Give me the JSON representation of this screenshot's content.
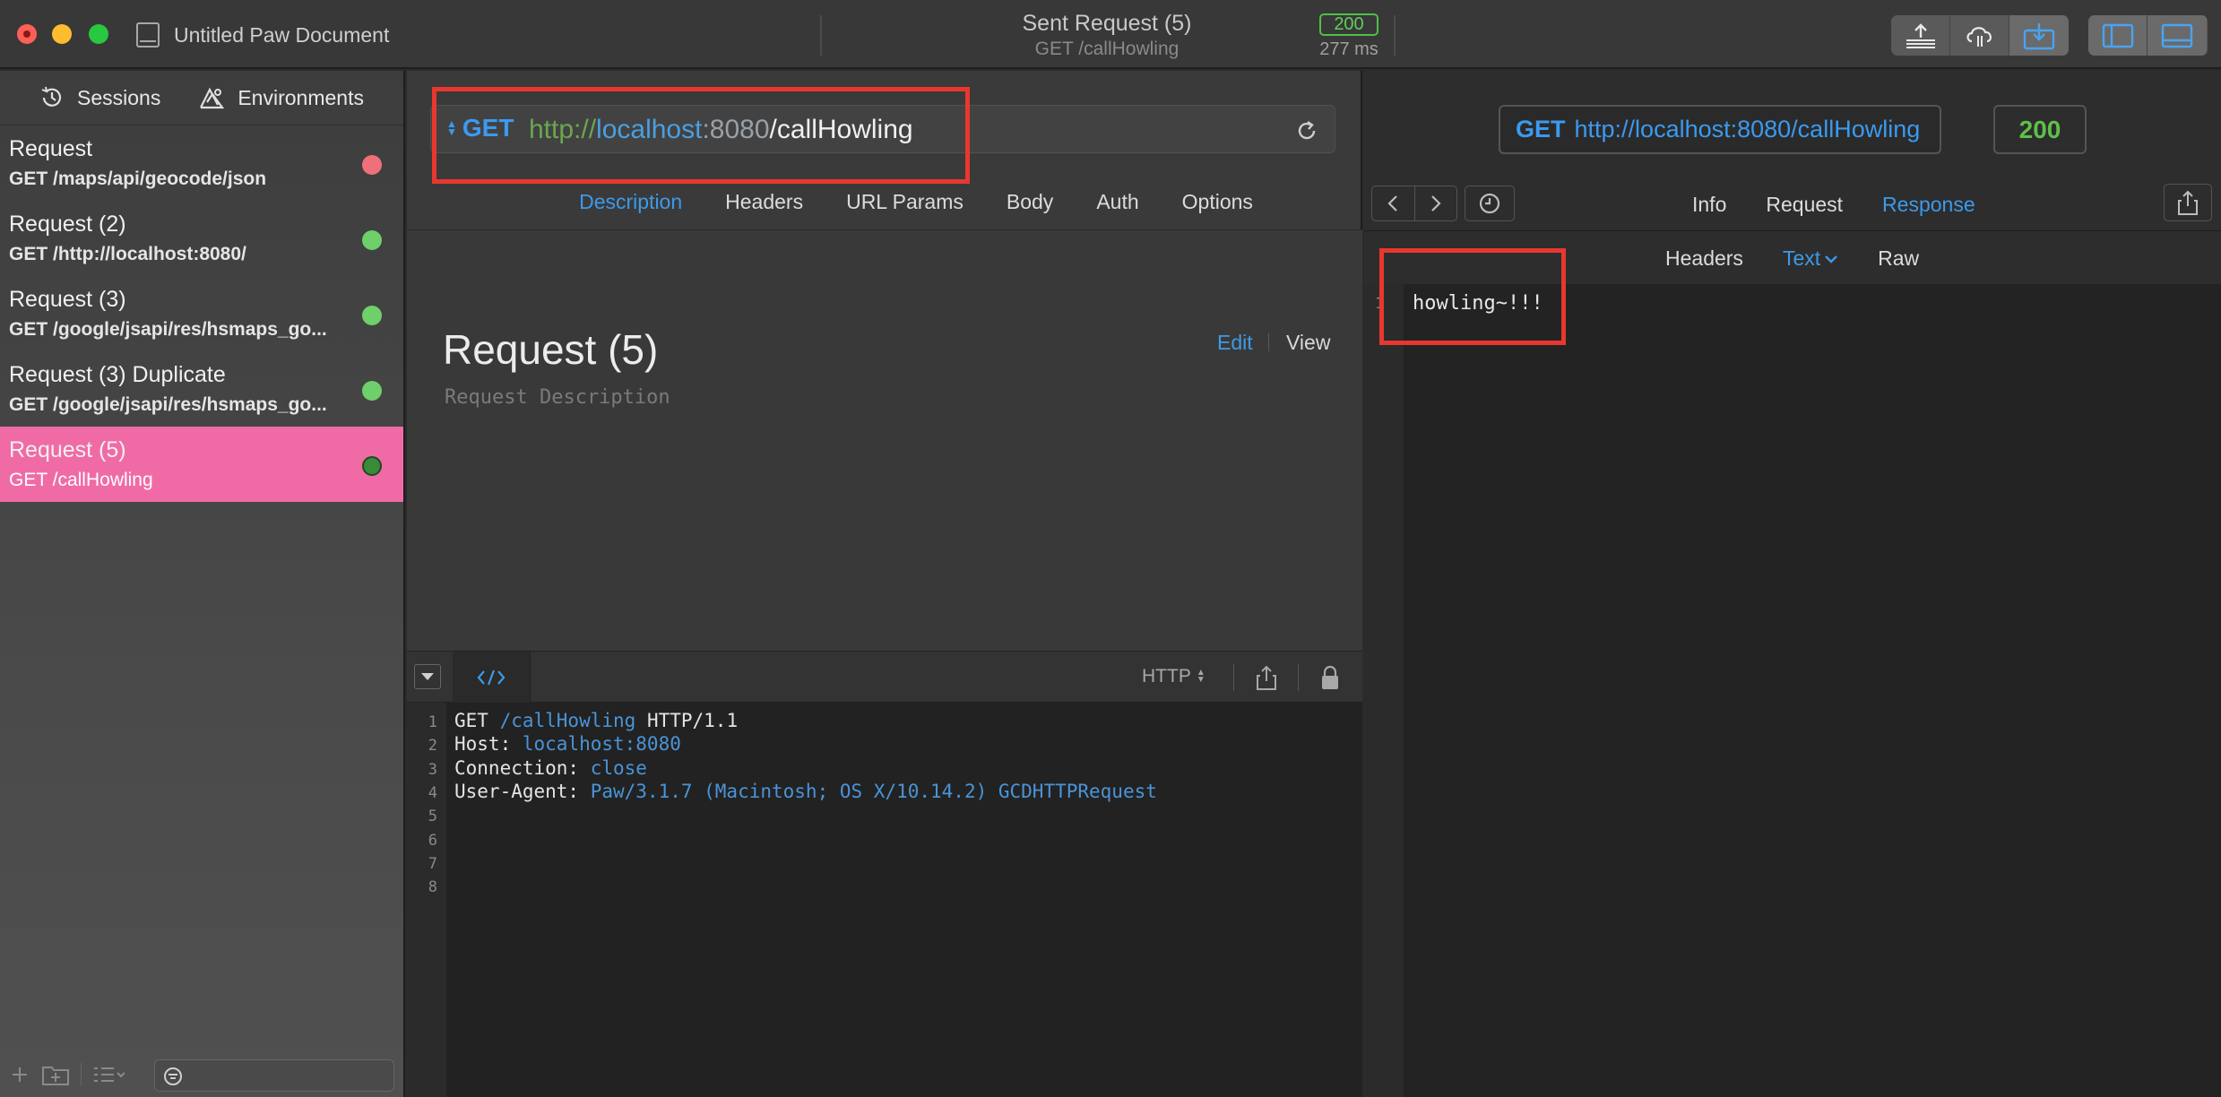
{
  "window": {
    "document_title": "Untitled Paw Document",
    "sent_title": "Sent Request (5)",
    "sent_subtitle": "GET /callHowling",
    "status_code": "200",
    "response_time": "277 ms"
  },
  "sidebar": {
    "tabs": [
      {
        "label": "Sessions",
        "icon": "clock-history-icon"
      },
      {
        "label": "Environments",
        "icon": "environment-icon"
      }
    ],
    "requests": [
      {
        "name": "Request",
        "sub": "GET /maps/api/geocode/json",
        "status_color": "#f0707a"
      },
      {
        "name": "Request (2)",
        "sub": "GET /http://localhost:8080/",
        "status_color": "#6fcf6a"
      },
      {
        "name": "Request (3)",
        "sub": "GET /google/jsapi/res/hsmaps_go...",
        "status_color": "#6fcf6a"
      },
      {
        "name": "Request (3) Duplicate",
        "sub": "GET /google/jsapi/res/hsmaps_go...",
        "status_color": "#6fcf6a"
      },
      {
        "name": "Request (5)",
        "sub": "GET /callHowling",
        "status_color": "#3a8a3a"
      }
    ]
  },
  "request": {
    "method": "GET",
    "url_scheme": "http://",
    "url_host": "localhost",
    "url_port": ":8080",
    "url_path": "/callHowling",
    "tabs": [
      "Description",
      "Headers",
      "URL Params",
      "Body",
      "Auth",
      "Options"
    ],
    "active_tab": "Description",
    "title": "Request (5)",
    "description_placeholder": "Request Description",
    "edit_label": "Edit",
    "view_label": "View",
    "code_format": "HTTP",
    "code_lines": [
      {
        "num": "1",
        "parts": [
          {
            "t": "GET "
          },
          {
            "t": "/callHowling",
            "c": "blue"
          },
          {
            "t": " HTTP/1.1"
          }
        ]
      },
      {
        "num": "2",
        "parts": [
          {
            "t": "Host: "
          },
          {
            "t": "localhost:8080",
            "c": "blue"
          }
        ]
      },
      {
        "num": "3",
        "parts": [
          {
            "t": "Connection: "
          },
          {
            "t": "close",
            "c": "blue"
          }
        ]
      },
      {
        "num": "4",
        "parts": [
          {
            "t": "User-Agent: "
          },
          {
            "t": "Paw/3.1.7 (Macintosh; OS X/10.14.2) GCDHTTPRequest",
            "c": "blue"
          }
        ]
      },
      {
        "num": "5",
        "parts": []
      },
      {
        "num": "6",
        "parts": []
      },
      {
        "num": "7",
        "parts": []
      },
      {
        "num": "8",
        "parts": []
      }
    ]
  },
  "response": {
    "method": "GET",
    "url": "http://localhost:8080/callHowling",
    "status": "200",
    "tabs": [
      "Info",
      "Request",
      "Response"
    ],
    "active_tab": "Response",
    "body_tabs": [
      "Headers",
      "Text",
      "Raw"
    ],
    "active_body_tab": "Text",
    "line_number": "1",
    "body": "howling~!!!"
  },
  "colors": {
    "accent": "#3d9ae8",
    "selected_row": "#f06ba6",
    "success": "#5fbf4a",
    "highlight_box": "#e8372f"
  }
}
